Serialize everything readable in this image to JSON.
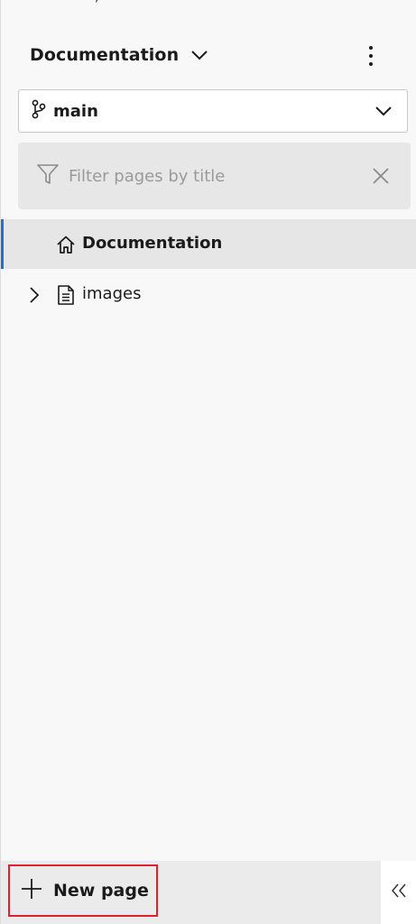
{
  "header": {
    "title": "Documentation"
  },
  "branch": {
    "label": "main"
  },
  "filter": {
    "placeholder": "Filter pages by title",
    "value": ""
  },
  "tree": {
    "items": [
      {
        "label": "Documentation",
        "icon": "home-icon",
        "selected": true
      },
      {
        "label": "images",
        "icon": "document-icon",
        "expandable": true
      }
    ]
  },
  "footer": {
    "new_page_label": "New page",
    "collapse_icon": "double-chevron-left-icon"
  },
  "colors": {
    "accent": "#1f6fd6",
    "highlight_border": "#e0202a",
    "panel_bg": "#f8f8f8",
    "filter_bg": "#e7e7e7",
    "selected_bg": "#e6e6e6"
  }
}
